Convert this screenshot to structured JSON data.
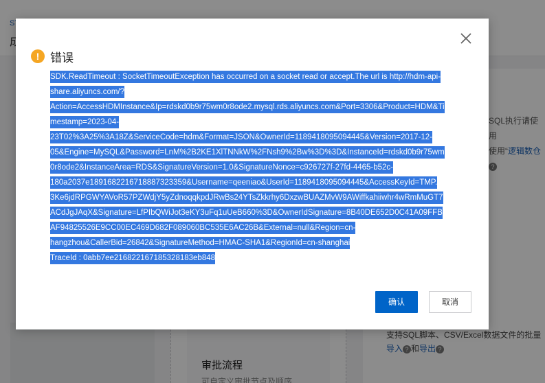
{
  "background": {
    "crumb": "ST",
    "title": "成",
    "right_top": {
      "text": "SQL执行请使用",
      "prefix": "使用",
      "link": "逻辑数仓"
    },
    "flow_card": {
      "title": "审批流程",
      "desc": "可自定义审批节点及顺序"
    },
    "right_bottom": {
      "text": "支持SQL脚本、CSV/Excel数据文件的批量",
      "link_import": "导入",
      "joiner": "和",
      "link_export": "导出"
    }
  },
  "dialog": {
    "title": "错误",
    "icon": "warning-icon",
    "message_lines": [
      "SDK.ReadTimeout : SocketTimeoutException has occurred on a socket read or accept.The url is http://hdm-api-",
      "share.aliyuncs.com/?",
      "Action=AccessHDMInstance&Ip=rdskd0b9r75wm0r8ode2.mysql.rds.aliyuncs.com&Port=3306&Product=HDM&Ti",
      "mestamp=2023-04-",
      "23T02%3A25%3A18Z&ServiceCode=hdm&Format=JSON&OwnerId=1189418095094445&Version=2017-12-",
      "05&Engine=MySQL&Password=LnM%2B2KE1XlTNNkW%2FNsh9%2Bw%3D%3D&InstanceId=rdskd0b9r75wm",
      "0r8ode2&InstanceArea=RDS&SignatureVersion=1.0&SignatureNonce=c926727f-27fd-4465-b52c-",
      "180a2037e1891682216718887323359&Username=qeeniao&UserId=1189418095094445&AccessKeyId=TMP.",
      "3Ke6jdRPGWYAVoR57PZWdjY5yZdnoqqkpdJRwBs24YTsZkkrhy6DxzwBUAZMvW9AWiffkahiiwhr4wRmMuGT7",
      "ACdJgJAqX&Signature=LfPIbQWiJot3eKY3uFq1uUeB660%3D&OwnerIdSignature=8B40DE652D0C41A09FFB",
      "AF94825526E9CC00EC469D682F089060BC535E6AC26B&External=null&Region=cn-",
      "hangzhou&CallerBid=26842&SignatureMethod=HMAC-SHA1&RegionId=cn-shanghai",
      "TraceId : 0abb7ee216822167185328183eb848"
    ],
    "ok_label": "确认",
    "cancel_label": "取消"
  },
  "colors": {
    "accent": "#0064c8",
    "selection": "#3478e0",
    "warning": "#f5a623"
  }
}
